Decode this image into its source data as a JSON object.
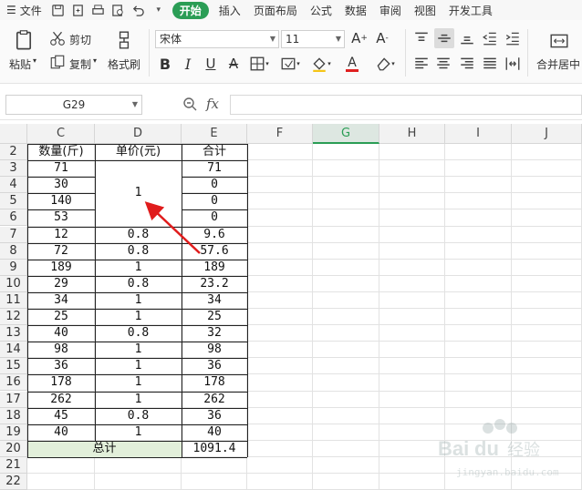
{
  "menu": {
    "file_label": "文件",
    "tabs": [
      "开始",
      "插入",
      "页面布局",
      "公式",
      "数据",
      "审阅",
      "视图",
      "开发工具"
    ]
  },
  "ribbon": {
    "paste_label": "粘贴",
    "cut_label": "剪切",
    "copy_label": "复制",
    "format_painter_label": "格式刷",
    "font_name": "宋体",
    "font_size": "11",
    "merge_center_label": "合并居中",
    "accent_color": "#2a9d55",
    "font_color": "#e02020"
  },
  "formula_bar": {
    "name_box": "G29",
    "fx_label": "fx",
    "formula": ""
  },
  "sheet": {
    "columns": [
      "C",
      "D",
      "E",
      "F",
      "G",
      "H",
      "I",
      "J"
    ],
    "selected_column": "G",
    "rows": [
      "2",
      "3",
      "4",
      "5",
      "6",
      "7",
      "8",
      "9",
      "10",
      "11",
      "12",
      "13",
      "14",
      "15",
      "16",
      "17",
      "18",
      "19",
      "20",
      "21",
      "22"
    ],
    "headers": {
      "quantity": "数量(斤)",
      "unit_price": "单价(元)",
      "total": "合计"
    },
    "data": [
      {
        "qty": "71",
        "price": "",
        "total": "71"
      },
      {
        "qty": "30",
        "price": "",
        "total": "0"
      },
      {
        "qty": "140",
        "price": "",
        "total": "0"
      },
      {
        "qty": "53",
        "price": "",
        "total": "0"
      },
      {
        "qty": "12",
        "price": "0.8",
        "total": "9.6"
      },
      {
        "qty": "72",
        "price": "0.8",
        "total": "57.6"
      },
      {
        "qty": "189",
        "price": "1",
        "total": "189"
      },
      {
        "qty": "29",
        "price": "0.8",
        "total": "23.2"
      },
      {
        "qty": "34",
        "price": "1",
        "total": "34"
      },
      {
        "qty": "25",
        "price": "1",
        "total": "25"
      },
      {
        "qty": "40",
        "price": "0.8",
        "total": "32"
      },
      {
        "qty": "98",
        "price": "1",
        "total": "98"
      },
      {
        "qty": "36",
        "price": "1",
        "total": "36"
      },
      {
        "qty": "178",
        "price": "1",
        "total": "178"
      },
      {
        "qty": "262",
        "price": "1",
        "total": "262"
      },
      {
        "qty": "45",
        "price": "0.8",
        "total": "36"
      },
      {
        "qty": "40",
        "price": "1",
        "total": "40"
      }
    ],
    "merged_price": "1",
    "summary_label": "总计",
    "summary_total": "1091.4",
    "summary_fill": "#e2efda",
    "arrow_color": "#e01c1c"
  }
}
